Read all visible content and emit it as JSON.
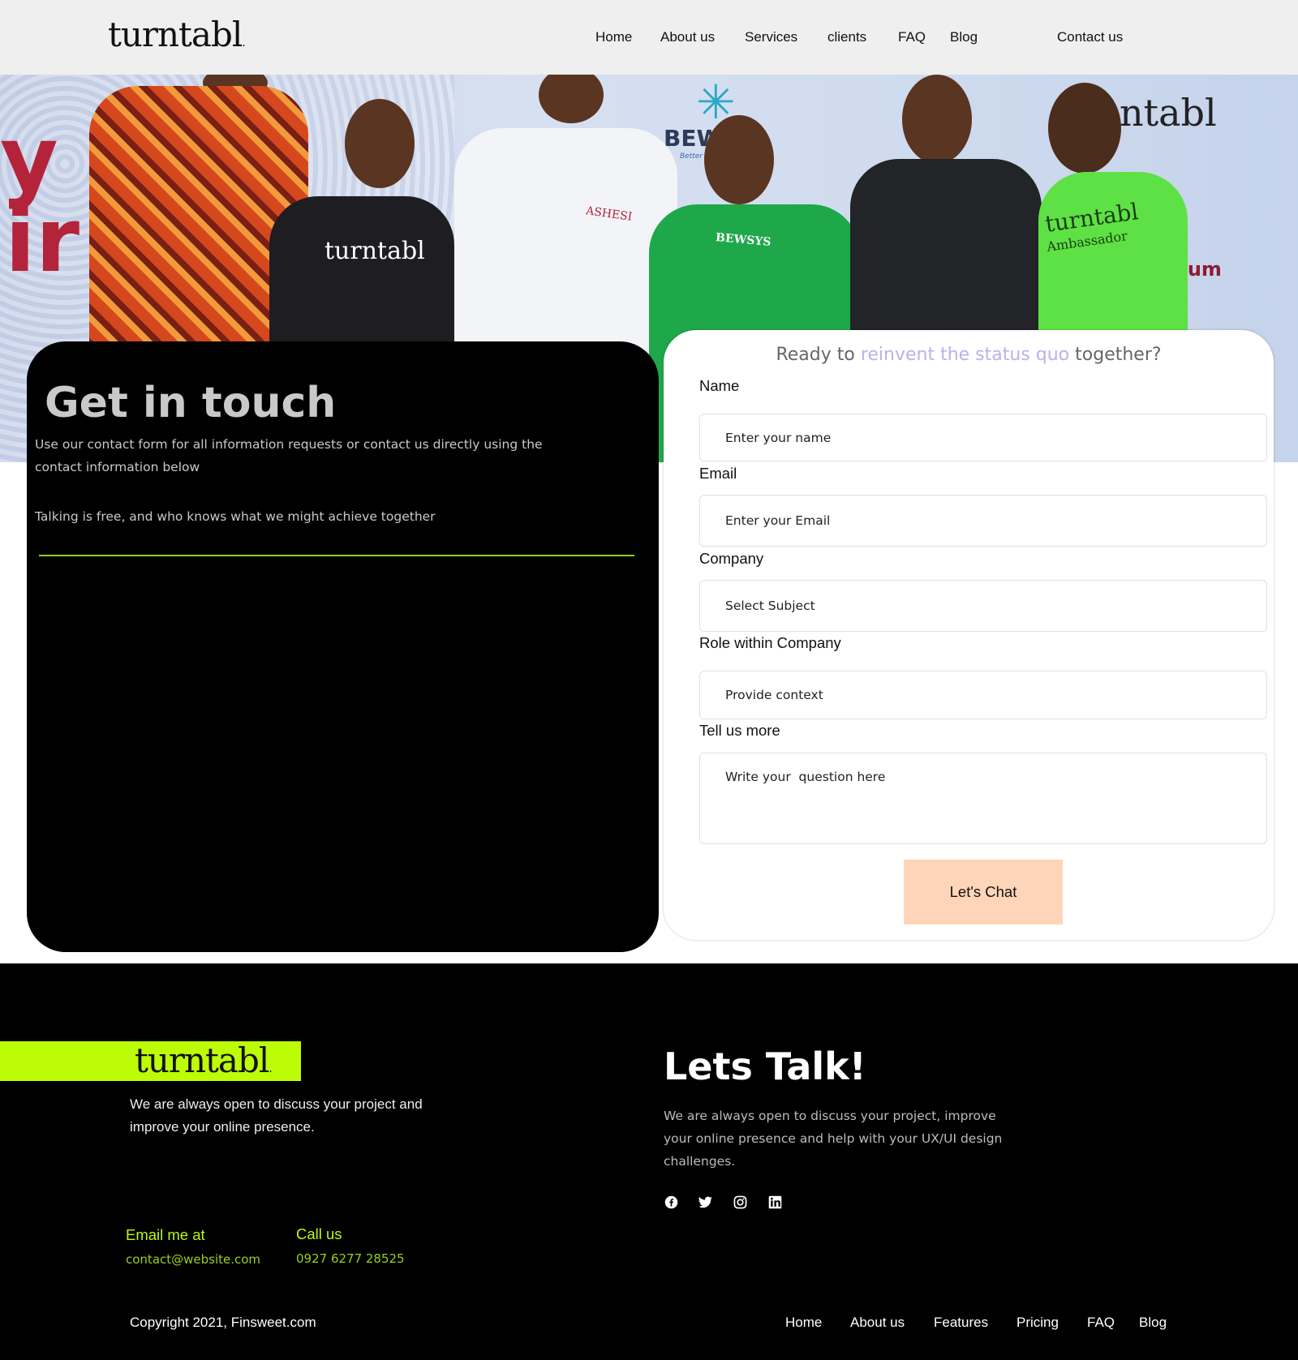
{
  "brand": {
    "logo_text": "turntabl"
  },
  "header": {
    "nav": [
      "Home",
      "About us",
      "Services",
      "clients",
      "FAQ",
      "Blog"
    ],
    "contact": "Contact us"
  },
  "hero": {
    "banner_fragments": {
      "red_top": "y",
      "red_bottom": "ir",
      "bew": "BEW",
      "bew_sub": "Better Worl",
      "turntabl_partial": "ntabl",
      "rum": "rum"
    },
    "shirts": {
      "tutor": "turntabl",
      "ashesi": "ASHESI",
      "bewsys": "BEWSYS",
      "ambassador_top": "turntabl",
      "ambassador_bottom": "Ambassador"
    }
  },
  "contact_panel": {
    "title": "Get in touch",
    "para1": "Use our contact form for all information requests or contact us directly using the contact information below",
    "para2": "Talking is free, and who knows what we might achieve together"
  },
  "form": {
    "title_start": "Ready to ",
    "title_highlight": "reinvent the status quo",
    "title_end": " together?",
    "name_label": "Name",
    "name_placeholder": "Enter your name",
    "email_label": "Email",
    "email_placeholder": "Enter your Email",
    "company_label": "Company",
    "company_selected": "Select Subject",
    "role_label": "Role within Company",
    "role_placeholder": "Provide context",
    "more_label": "Tell us more",
    "more_placeholder": "Write your  question here",
    "submit": "Let's Chat"
  },
  "footer": {
    "logo_text": "turntabl",
    "description": "We are always open to discuss your project and improve your online presence.",
    "email_label": "Email me at",
    "email": "contact@website.com",
    "call_label": "Call us",
    "phone": "0927 6277 28525",
    "lets_talk": "Lets Talk!",
    "lets_talk_desc": "We are always open to discuss your project, improve your online presence and help with your UX/UI design challenges.",
    "social_icons": [
      "facebook-icon",
      "twitter-icon",
      "instagram-icon",
      "linkedin-icon"
    ],
    "copyright": "Copyright 2021, Finsweet.com",
    "nav": [
      "Home",
      "About us",
      "Features",
      "Pricing",
      "FAQ",
      "Blog"
    ]
  },
  "colors": {
    "accent_lime": "#bdfc07",
    "button_peach": "#fed5b9",
    "highlight_lavender": "#b9b2ec",
    "divider_green": "#8fcf20"
  }
}
